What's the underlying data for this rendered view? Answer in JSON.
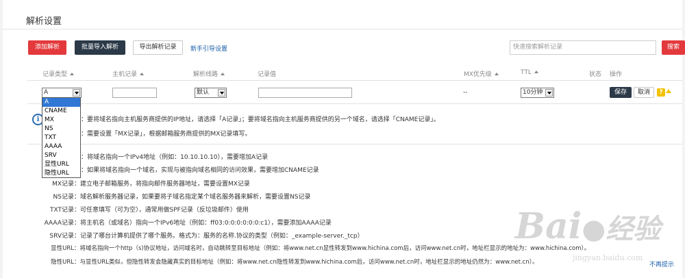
{
  "page": {
    "title": "解析设置"
  },
  "toolbar": {
    "add_label": "添加解析",
    "batch_import_label": "批量导入解析",
    "export_label": "导出解析记录",
    "guide_label": "新手引导设置",
    "search_placeholder": "快速搜索解析记录",
    "search_button_label": "搜索"
  },
  "table": {
    "columns": [
      "记录类型",
      "主机记录",
      "解析线路",
      "记录值",
      "MX优先级",
      "TTL",
      "状态",
      "操作"
    ]
  },
  "edit_row": {
    "type_value": "A",
    "line_value": "默认",
    "mx_value": "--",
    "ttl_value": "10分钟",
    "save_label": "保存",
    "cancel_label": "取消"
  },
  "type_options": [
    "A",
    "CNAME",
    "MX",
    "NS",
    "TXT",
    "AAAA",
    "SRV",
    "显性URL",
    "隐性URL"
  ],
  "info": {
    "line1": "：要将域名指向主机服务商提供的IP地址，请选择「A记录」；要将域名指向主机服务商提供的另一个域名，请选择「CNAME记录」。",
    "line2": "：需要设置「MX记录」，根据邮箱服务商提供的MX记录填写。"
  },
  "help": {
    "a_text": "：将域名指向一个IPv4地址（例如：10.10.10.10），需要增加A记录",
    "cname_text": "：如果将域名指向一个域名，实现与被指向域名相同的访问效果，需要增加CNAME记录",
    "rows": [
      {
        "label": "MX记录",
        "text": "：建立电子邮箱服务，将指向邮件服务器地址，需要设置MX记录"
      },
      {
        "label": "NS记录",
        "text": "：域名解析服务器记录，如果要将子域名指定某个域名服务器来解析，需要设置NS记录"
      },
      {
        "label": "TXT记录",
        "text": "：可任意填写（可为空），通常用做SPF记录（反垃圾邮件）使用"
      },
      {
        "label": "AAAA记录",
        "text": "：将主机名（或域名）指向一个IPv6地址（例如：ff03:0:0:0:0:0:0:c1），需要添加AAAA记录"
      },
      {
        "label": "SRV记录",
        "text": "：记录了哪台计算机提供了哪个服务。格式为：服务的名称.协议的类型（例如：_example-server._tcp）"
      },
      {
        "label": "显性URL",
        "text": "：将域名指向一个http（s)协议地址，访问域名时，自动跳转至目标地址（例如：将www.net.cn显性转发到www.hichina.com后，访问www.net.cn时，地址栏显示的地址为：www.hichina.com）。"
      },
      {
        "label": "隐性URL",
        "text": "：与显性URL类似，但隐性转发会隐藏真实的目标地址（例如：将www.net.cn隐性转发到www.hichina.com后，访问www.net.cn时，地址栏显示的地址仍然为：www.net.cn）。"
      }
    ],
    "dismiss_label": "不再提示"
  },
  "watermark": {
    "brand": "Bai",
    "brand2": "经验",
    "url": "jingyan.baidu.com"
  }
}
